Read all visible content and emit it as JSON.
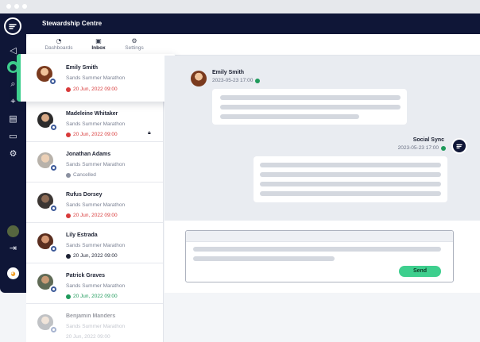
{
  "app": {
    "title": "Stewardship Centre"
  },
  "tabs": [
    {
      "label": "Dashboards",
      "icon": "gauge-icon"
    },
    {
      "label": "Inbox",
      "icon": "inbox-icon"
    },
    {
      "label": "Settings",
      "icon": "gear-icon"
    }
  ],
  "conversations": [
    {
      "name": "Emily Smith",
      "event": "Sands Summer Marathon",
      "status": "20 Jun, 2022 09:00",
      "status_type": "overdue"
    },
    {
      "name": "Madeleine Whitaker",
      "event": "Sands Summer Marathon",
      "status": "20 Jun, 2022 09:00",
      "status_type": "overdue",
      "locked": true
    },
    {
      "name": "Jonathan Adams",
      "event": "Sands Summer Marathon",
      "status": "Cancelled",
      "status_type": "cancelled"
    },
    {
      "name": "Rufus Dorsey",
      "event": "Sands Summer Marathon",
      "status": "20 Jun, 2022 09:00",
      "status_type": "overdue"
    },
    {
      "name": "Lily Estrada",
      "event": "Sands Summer Marathon",
      "status": "20 Jun, 2022 09:00",
      "status_type": "scheduled"
    },
    {
      "name": "Patrick Graves",
      "event": "Sands Summer Marathon",
      "status": "20 Jun, 2022 09:00",
      "status_type": "done"
    },
    {
      "name": "Benjamin Manders",
      "event": "Sands Summer Marathon",
      "status": "20 Jun, 2022 09:00",
      "status_type": "none"
    }
  ],
  "thread": {
    "incoming": {
      "sender": "Emily Smith",
      "time": "2023-05-23 17:00"
    },
    "outgoing": {
      "sender": "Social Sync",
      "time": "2023-05-23 17:00"
    }
  },
  "composer": {
    "send_label": "Send"
  },
  "colors": {
    "navy": "#0f1637",
    "accent_green": "#3ecf8e",
    "overdue_red": "#d83a3a",
    "success_green": "#1f9a5b"
  }
}
